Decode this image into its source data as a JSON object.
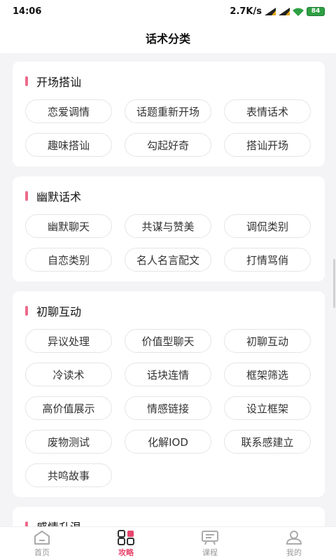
{
  "status": {
    "time": "14:06",
    "speed": "2.7K/s",
    "battery": "84"
  },
  "header": {
    "title": "话术分类"
  },
  "sections": [
    {
      "title": "开场搭讪",
      "tags": [
        "恋爱调情",
        "话题重新开场",
        "表情话术",
        "趣味搭讪",
        "勾起好奇",
        "搭讪开场"
      ]
    },
    {
      "title": "幽默话术",
      "tags": [
        "幽默聊天",
        "共谋与赞美",
        "调侃类别",
        "自恋类别",
        "名人名言配文",
        "打情骂俏"
      ]
    },
    {
      "title": "初聊互动",
      "tags": [
        "异议处理",
        "价值型聊天",
        "初聊互动",
        "冷读术",
        "话块连情",
        "框架筛选",
        "高价值展示",
        "情感链接",
        "设立框架",
        "废物测试",
        "化解IOD",
        "联系感建立",
        "共鸣故事"
      ]
    },
    {
      "title": "感情升温",
      "tags": []
    }
  ],
  "tabbar": {
    "items": [
      {
        "label": "首页",
        "icon": "home-icon",
        "active": false
      },
      {
        "label": "攻略",
        "icon": "grid-icon",
        "active": true
      },
      {
        "label": "课程",
        "icon": "course-icon",
        "active": false
      },
      {
        "label": "我的",
        "icon": "user-icon",
        "active": false
      }
    ],
    "active_color": "#e8476d"
  },
  "colors": {
    "accent": "#ee6a8b"
  }
}
